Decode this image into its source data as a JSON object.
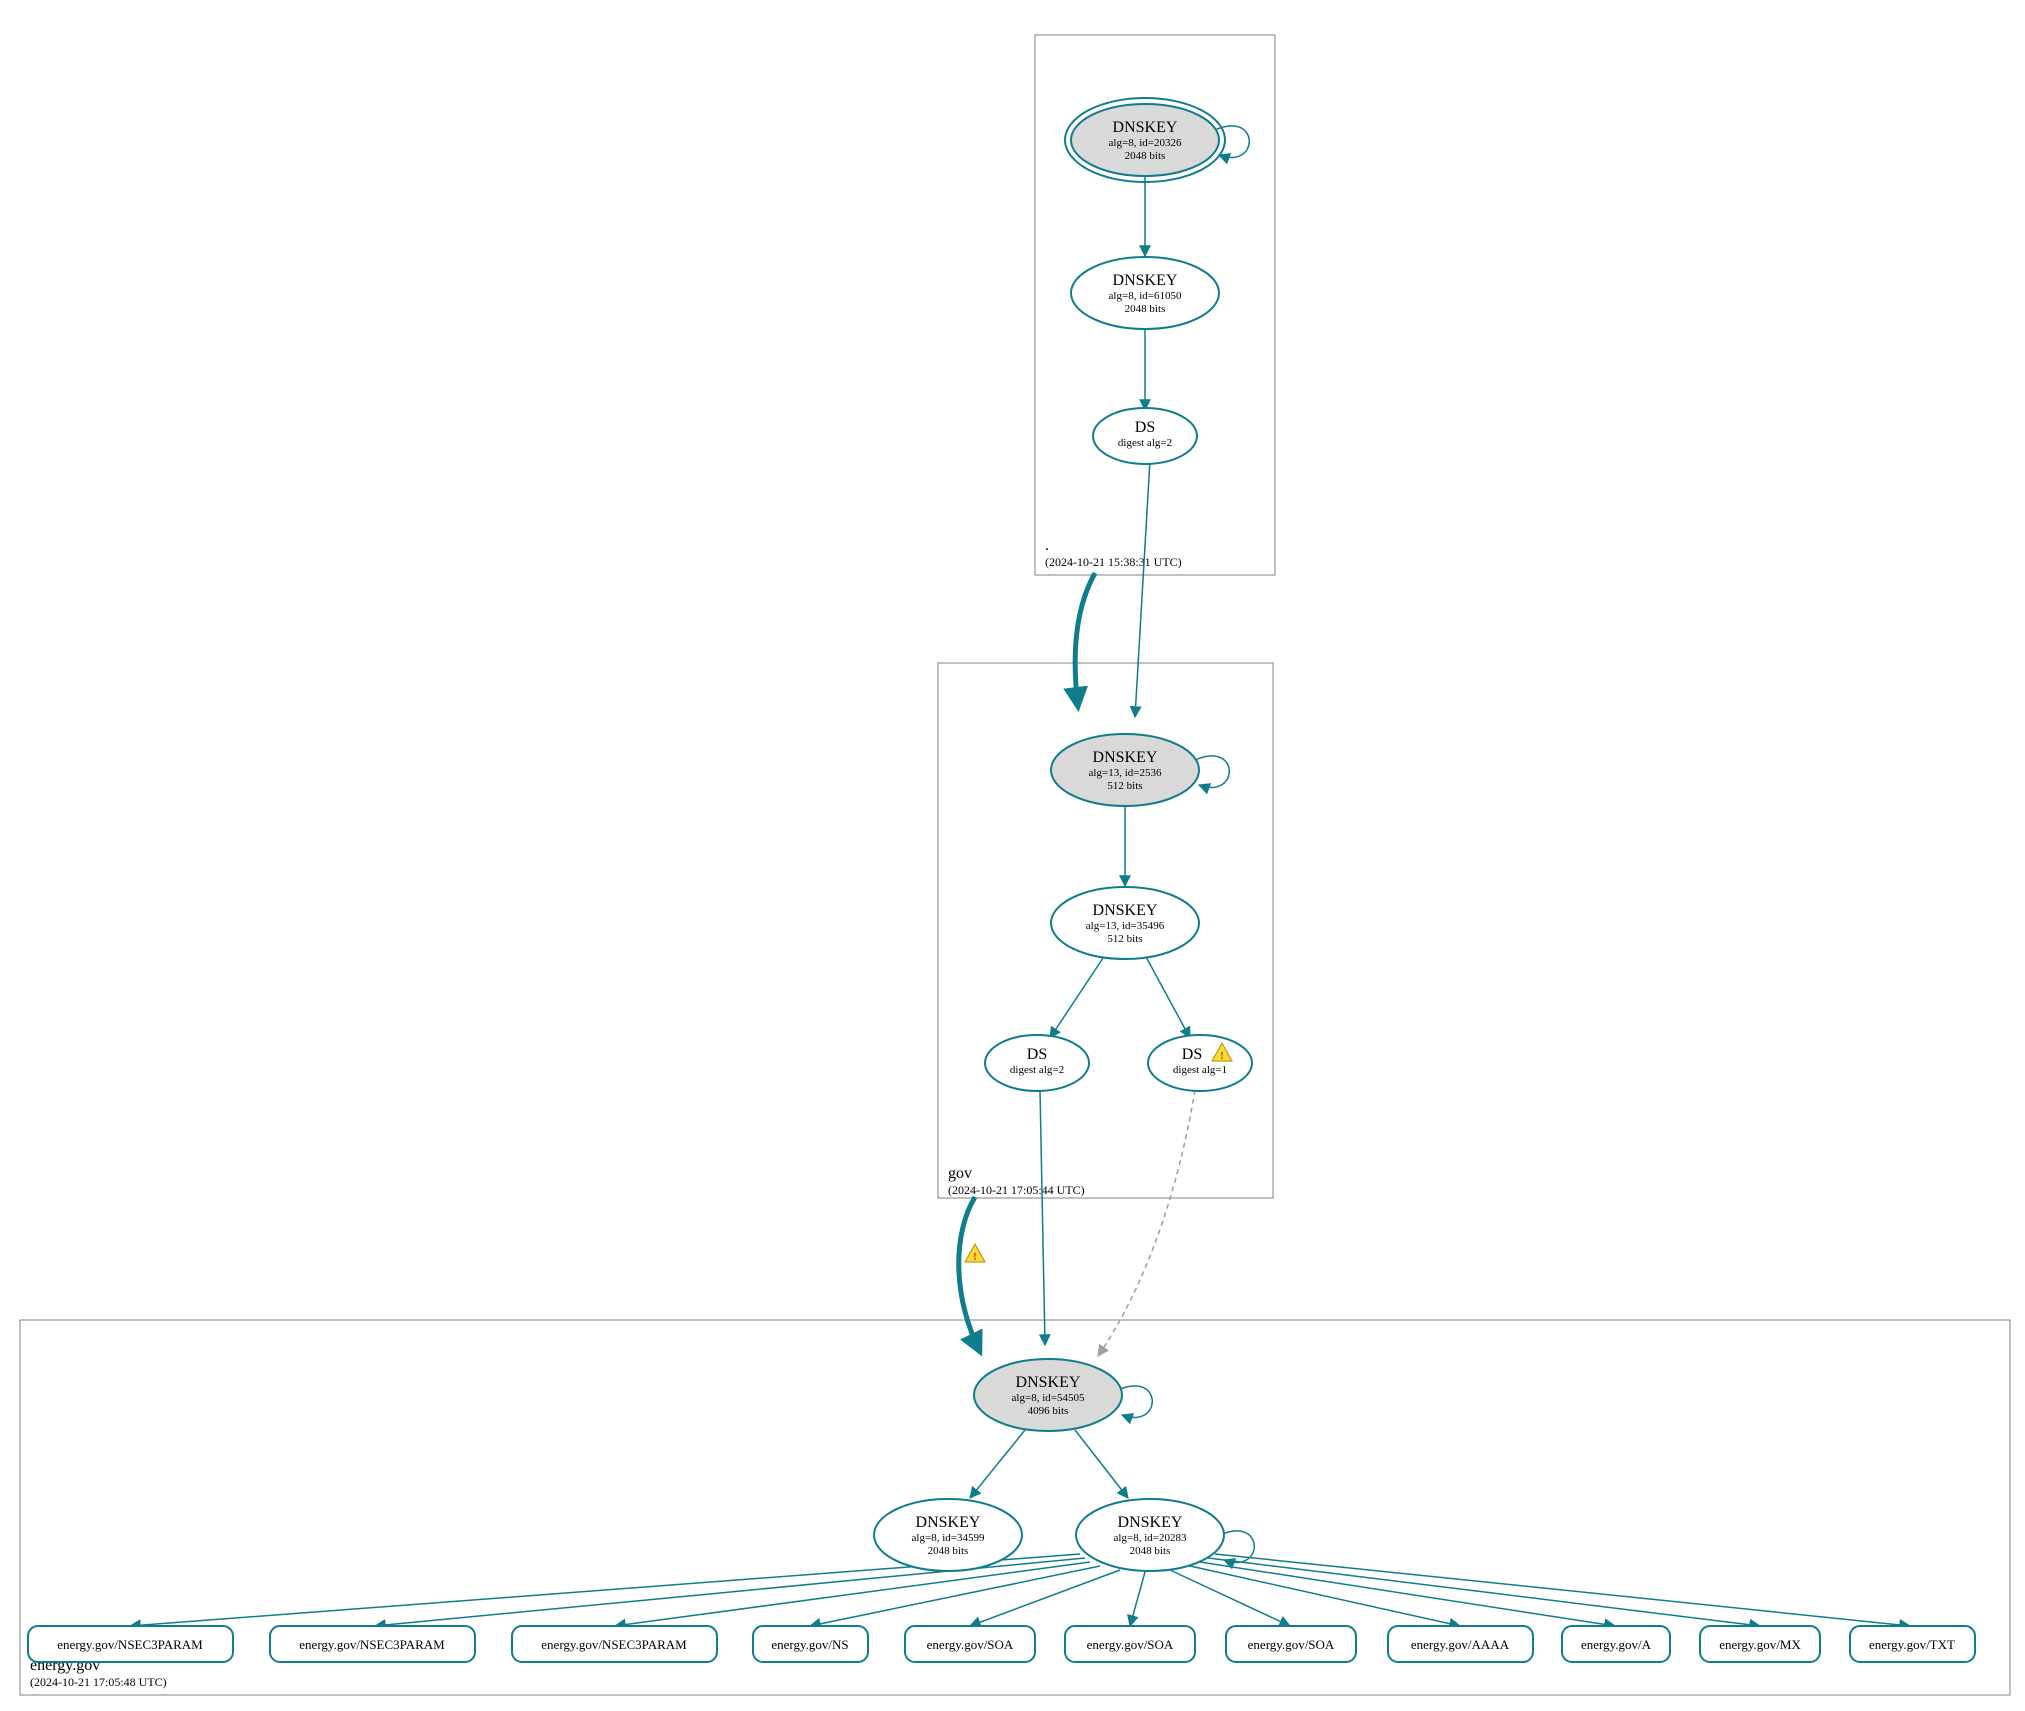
{
  "zones": {
    "root": {
      "label": ".",
      "timestamp": "(2024-10-21 15:38:31 UTC)"
    },
    "gov": {
      "label": "gov",
      "timestamp": "(2024-10-21 17:05:44 UTC)"
    },
    "energy": {
      "label": "energy.gov",
      "timestamp": "(2024-10-21 17:05:48 UTC)"
    }
  },
  "nodes": {
    "root_ksk": {
      "title": "DNSKEY",
      "l1": "alg=8, id=20326",
      "l2": "2048 bits"
    },
    "root_zsk": {
      "title": "DNSKEY",
      "l1": "alg=8, id=61050",
      "l2": "2048 bits"
    },
    "root_ds": {
      "title": "DS",
      "l1": "digest alg=2",
      "l2": ""
    },
    "gov_ksk": {
      "title": "DNSKEY",
      "l1": "alg=13, id=2536",
      "l2": "512 bits"
    },
    "gov_zsk": {
      "title": "DNSKEY",
      "l1": "alg=13, id=35496",
      "l2": "512 bits"
    },
    "gov_ds2": {
      "title": "DS",
      "l1": "digest alg=2",
      "l2": ""
    },
    "gov_ds1": {
      "title": "DS",
      "l1": "digest alg=1",
      "l2": ""
    },
    "eg_ksk": {
      "title": "DNSKEY",
      "l1": "alg=8, id=54505",
      "l2": "4096 bits"
    },
    "eg_zsk1": {
      "title": "DNSKEY",
      "l1": "alg=8, id=34599",
      "l2": "2048 bits"
    },
    "eg_zsk2": {
      "title": "DNSKEY",
      "l1": "alg=8, id=20283",
      "l2": "2048 bits"
    }
  },
  "rrsets": [
    "energy.gov/NSEC3PARAM",
    "energy.gov/NSEC3PARAM",
    "energy.gov/NSEC3PARAM",
    "energy.gov/NS",
    "energy.gov/SOA",
    "energy.gov/SOA",
    "energy.gov/SOA",
    "energy.gov/AAAA",
    "energy.gov/A",
    "energy.gov/MX",
    "energy.gov/TXT"
  ],
  "chart_data": {
    "type": "dnssec-auth-graph",
    "zones": [
      {
        "name": ".",
        "timestamp": "2024-10-21 15:38:31 UTC"
      },
      {
        "name": "gov",
        "timestamp": "2024-10-21 17:05:44 UTC"
      },
      {
        "name": "energy.gov",
        "timestamp": "2024-10-21 17:05:48 UTC"
      }
    ],
    "nodes": [
      {
        "id": "root_ksk",
        "zone": ".",
        "type": "DNSKEY",
        "alg": 8,
        "key_id": 20326,
        "bits": 2048,
        "sep": true
      },
      {
        "id": "root_zsk",
        "zone": ".",
        "type": "DNSKEY",
        "alg": 8,
        "key_id": 61050,
        "bits": 2048,
        "sep": false
      },
      {
        "id": "root_ds",
        "zone": ".",
        "type": "DS",
        "digest_alg": 2
      },
      {
        "id": "gov_ksk",
        "zone": "gov",
        "type": "DNSKEY",
        "alg": 13,
        "key_id": 2536,
        "bits": 512,
        "sep": true
      },
      {
        "id": "gov_zsk",
        "zone": "gov",
        "type": "DNSKEY",
        "alg": 13,
        "key_id": 35496,
        "bits": 512,
        "sep": false
      },
      {
        "id": "gov_ds2",
        "zone": "gov",
        "type": "DS",
        "digest_alg": 2
      },
      {
        "id": "gov_ds1",
        "zone": "gov",
        "type": "DS",
        "digest_alg": 1,
        "warning": true
      },
      {
        "id": "eg_ksk",
        "zone": "energy.gov",
        "type": "DNSKEY",
        "alg": 8,
        "key_id": 54505,
        "bits": 4096,
        "sep": true
      },
      {
        "id": "eg_zsk1",
        "zone": "energy.gov",
        "type": "DNSKEY",
        "alg": 8,
        "key_id": 34599,
        "bits": 2048,
        "sep": false
      },
      {
        "id": "eg_zsk2",
        "zone": "energy.gov",
        "type": "DNSKEY",
        "alg": 8,
        "key_id": 20283,
        "bits": 2048,
        "sep": false
      }
    ],
    "rr_nodes": [
      {
        "id": "rr0",
        "zone": "energy.gov",
        "name": "energy.gov",
        "rrtype": "NSEC3PARAM"
      },
      {
        "id": "rr1",
        "zone": "energy.gov",
        "name": "energy.gov",
        "rrtype": "NSEC3PARAM"
      },
      {
        "id": "rr2",
        "zone": "energy.gov",
        "name": "energy.gov",
        "rrtype": "NSEC3PARAM"
      },
      {
        "id": "rr3",
        "zone": "energy.gov",
        "name": "energy.gov",
        "rrtype": "NS"
      },
      {
        "id": "rr4",
        "zone": "energy.gov",
        "name": "energy.gov",
        "rrtype": "SOA"
      },
      {
        "id": "rr5",
        "zone": "energy.gov",
        "name": "energy.gov",
        "rrtype": "SOA"
      },
      {
        "id": "rr6",
        "zone": "energy.gov",
        "name": "energy.gov",
        "rrtype": "SOA"
      },
      {
        "id": "rr7",
        "zone": "energy.gov",
        "name": "energy.gov",
        "rrtype": "AAAA"
      },
      {
        "id": "rr8",
        "zone": "energy.gov",
        "name": "energy.gov",
        "rrtype": "A"
      },
      {
        "id": "rr9",
        "zone": "energy.gov",
        "name": "energy.gov",
        "rrtype": "MX"
      },
      {
        "id": "rr10",
        "zone": "energy.gov",
        "name": "energy.gov",
        "rrtype": "TXT"
      }
    ],
    "edges": [
      {
        "from": "root_ksk",
        "to": "root_ksk",
        "kind": "self-sign"
      },
      {
        "from": "root_ksk",
        "to": "root_zsk",
        "kind": "sign"
      },
      {
        "from": "root_zsk",
        "to": "root_ds",
        "kind": "sign"
      },
      {
        "from": "root_ds",
        "to": "gov_ksk",
        "kind": "delegation"
      },
      {
        "from": "root_ds",
        "to": "gov_ksk",
        "kind": "secure-delegation-bold"
      },
      {
        "from": "gov_ksk",
        "to": "gov_ksk",
        "kind": "self-sign"
      },
      {
        "from": "gov_ksk",
        "to": "gov_zsk",
        "kind": "sign"
      },
      {
        "from": "gov_zsk",
        "to": "gov_ds2",
        "kind": "sign"
      },
      {
        "from": "gov_zsk",
        "to": "gov_ds1",
        "kind": "sign"
      },
      {
        "from": "gov_ds2",
        "to": "eg_ksk",
        "kind": "delegation"
      },
      {
        "from": "gov_ds2",
        "to": "eg_ksk",
        "kind": "secure-delegation-bold",
        "warning": true
      },
      {
        "from": "gov_ds1",
        "to": "eg_ksk",
        "kind": "delegation-insecure"
      },
      {
        "from": "eg_ksk",
        "to": "eg_ksk",
        "kind": "self-sign"
      },
      {
        "from": "eg_ksk",
        "to": "eg_zsk1",
        "kind": "sign"
      },
      {
        "from": "eg_ksk",
        "to": "eg_zsk2",
        "kind": "sign"
      },
      {
        "from": "eg_zsk2",
        "to": "eg_zsk2",
        "kind": "self-sign"
      },
      {
        "from": "eg_zsk2",
        "to": "rr0",
        "kind": "sign"
      },
      {
        "from": "eg_zsk2",
        "to": "rr1",
        "kind": "sign"
      },
      {
        "from": "eg_zsk2",
        "to": "rr2",
        "kind": "sign"
      },
      {
        "from": "eg_zsk2",
        "to": "rr3",
        "kind": "sign"
      },
      {
        "from": "eg_zsk2",
        "to": "rr4",
        "kind": "sign"
      },
      {
        "from": "eg_zsk2",
        "to": "rr5",
        "kind": "sign"
      },
      {
        "from": "eg_zsk2",
        "to": "rr6",
        "kind": "sign"
      },
      {
        "from": "eg_zsk2",
        "to": "rr7",
        "kind": "sign"
      },
      {
        "from": "eg_zsk2",
        "to": "rr8",
        "kind": "sign"
      },
      {
        "from": "eg_zsk2",
        "to": "rr9",
        "kind": "sign"
      },
      {
        "from": "eg_zsk2",
        "to": "rr10",
        "kind": "sign"
      }
    ]
  }
}
